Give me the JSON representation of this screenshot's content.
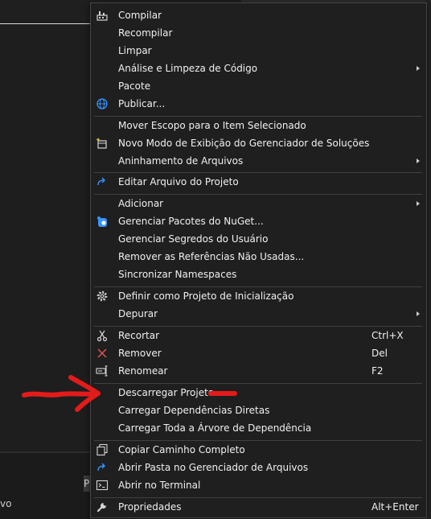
{
  "background": {
    "status_text": "vo",
    "tiny_button_text": "P"
  },
  "menu": {
    "items": [
      {
        "label": "Compilar",
        "icon": "build-icon"
      },
      {
        "label": "Recompilar"
      },
      {
        "label": "Limpar"
      },
      {
        "label": "Análise e Limpeza de Código",
        "submenu": true
      },
      {
        "label": "Pacote"
      },
      {
        "label": "Publicar...",
        "icon": "globe-icon"
      },
      {
        "label": "Mover Escopo para o Item Selecionado"
      },
      {
        "label": "Novo Modo de Exibição do Gerenciador de Soluções",
        "icon": "new-view-icon"
      },
      {
        "label": "Aninhamento de Arquivos",
        "submenu": true
      },
      {
        "label": "Editar Arquivo do Projeto",
        "icon": "redo-arrow-icon"
      },
      {
        "label": "Adicionar",
        "submenu": true
      },
      {
        "label": "Gerenciar Pacotes do NuGet...",
        "icon": "nuget-icon"
      },
      {
        "label": "Gerenciar Segredos do Usuário"
      },
      {
        "label": "Remover as Referências Não Usadas..."
      },
      {
        "label": "Sincronizar Namespaces"
      },
      {
        "label": "Definir como Projeto de Inicialização",
        "icon": "gear-icon"
      },
      {
        "label": "Depurar",
        "submenu": true
      },
      {
        "label": "Recortar",
        "icon": "scissors-icon",
        "shortcut": "Ctrl+X"
      },
      {
        "label": "Remover",
        "icon": "delete-x-icon",
        "shortcut": "Del"
      },
      {
        "label": "Renomear",
        "icon": "rename-icon",
        "shortcut": "F2"
      },
      {
        "label": "Descarregar Projeto"
      },
      {
        "label": "Carregar Dependências Diretas"
      },
      {
        "label": "Carregar Toda a Árvore de Dependência"
      },
      {
        "label": "Copiar Caminho Completo",
        "icon": "copy-icon"
      },
      {
        "label": "Abrir Pasta no Gerenciador de Arquivos",
        "icon": "redo-arrow-icon"
      },
      {
        "label": "Abrir no Terminal",
        "icon": "terminal-icon"
      },
      {
        "label": "Propriedades",
        "icon": "wrench-icon",
        "shortcut": "Alt+Enter"
      }
    ]
  },
  "colors": {
    "menu_bg": "#1f1f1f",
    "separator": "#3f3f46",
    "annotation_red": "#e31b1b",
    "icon_blue": "#3794ff",
    "delete_red": "#e05555"
  }
}
